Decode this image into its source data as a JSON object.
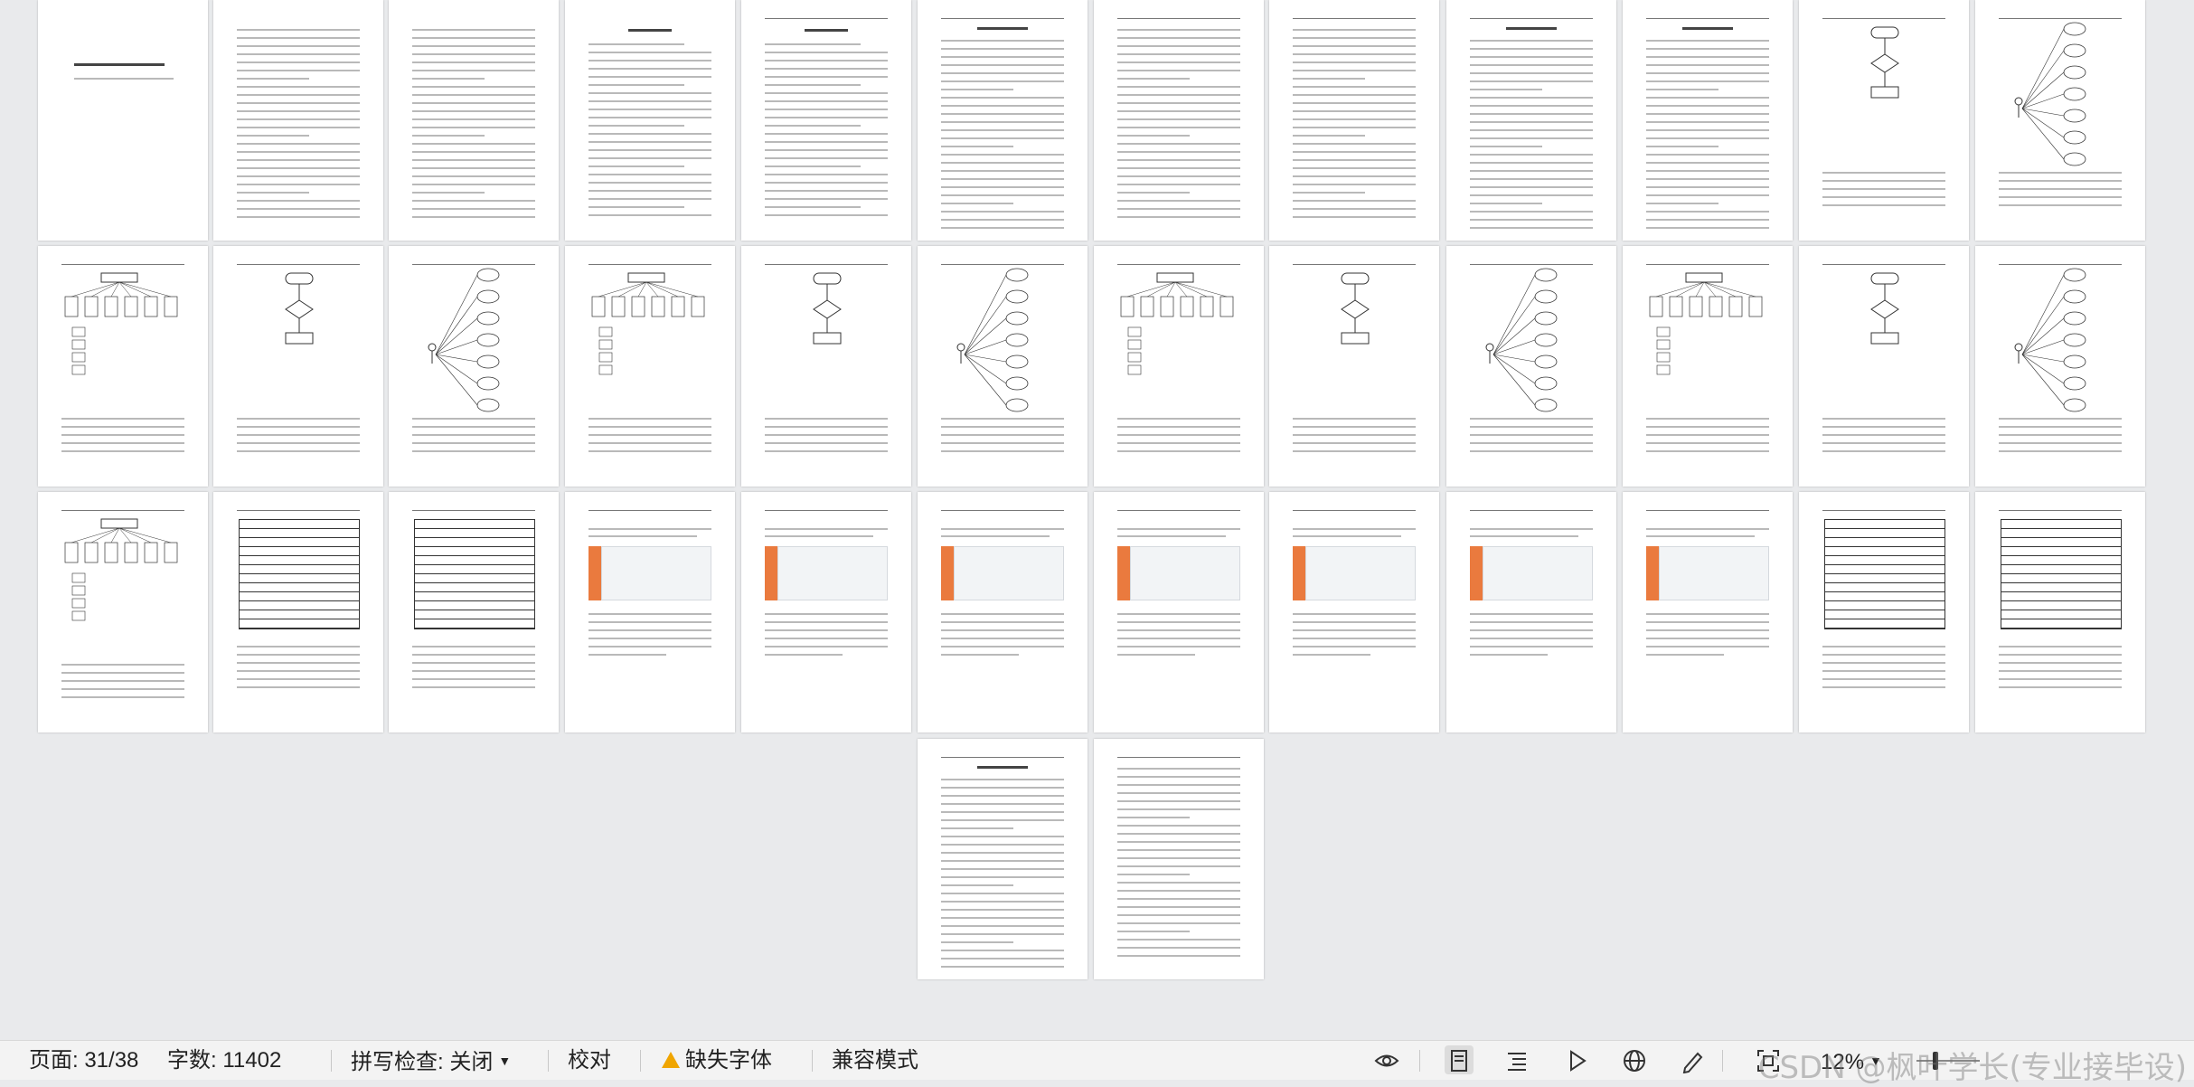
{
  "status_bar": {
    "page_label": "页面: 31/38",
    "word_count_label": "字数: 11402",
    "spellcheck_label": "拼写检查: 关闭",
    "proofread_label": "校对",
    "missing_fonts_label": "缺失字体",
    "compat_mode_label": "兼容模式",
    "zoom_label": "12%",
    "watermark": "CSDN @枫叶学长(专业接毕设)"
  },
  "document": {
    "cover_title": "毕 业 设 计（论 文）",
    "abstract_cn_heading": "摘 要",
    "abstract_en_heading": "Abstract",
    "toc_heading": "目 录",
    "chapter_headings": [
      "第1章 绪论",
      "第2章 开发环境介绍",
      "第3章 系统分析",
      "第4章 系统设计",
      "第5章 系统实现",
      "第6章 系统测试",
      "结 论",
      "致 谢",
      "参考文献"
    ]
  },
  "colors": {
    "workspace_bg": "#e9eaec",
    "page_bg": "#ffffff",
    "screenshot_accent": "#ea7a3e",
    "warning": "#f0a500"
  },
  "icons": [
    "warning-icon",
    "eye-icon",
    "page-view-icon",
    "outline-view-icon",
    "play-icon",
    "web-view-icon",
    "pen-icon",
    "fit-page-icon",
    "chevron-down-icon"
  ]
}
